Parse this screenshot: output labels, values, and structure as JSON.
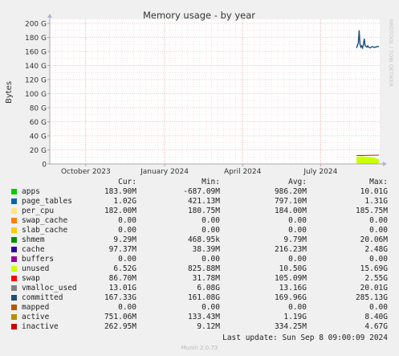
{
  "chart_data": {
    "type": "line",
    "title": "Memory usage - by year",
    "ylabel": "Bytes",
    "side_label": "RRDTOOL / TOBI OETIKER",
    "ylim": [
      0,
      200
    ],
    "yticks": [
      0,
      20,
      40,
      60,
      80,
      100,
      120,
      140,
      160,
      180,
      200
    ],
    "ytick_labels": [
      "0",
      "20 G",
      "40 G",
      "60 G",
      "80 G",
      "100 G",
      "120 G",
      "140 G",
      "160 G",
      "180 G",
      "200 G"
    ],
    "x_range": [
      "2023-08-20",
      "2024-09-08"
    ],
    "xticks": [
      "2023-10-01",
      "2024-01-01",
      "2024-04-01",
      "2024-07-01"
    ],
    "xtick_labels": [
      "October 2023",
      "January 2024",
      "April 2024",
      "July 2024"
    ],
    "grid": true,
    "series": [
      {
        "name": "committed",
        "color": "#1f4e79",
        "x": [
          "2024-08-12",
          "2024-08-14",
          "2024-08-15",
          "2024-08-16",
          "2024-08-17",
          "2024-08-18",
          "2024-08-19",
          "2024-08-20",
          "2024-08-21",
          "2024-08-22",
          "2024-08-23",
          "2024-08-24",
          "2024-08-25",
          "2024-08-26",
          "2024-08-28",
          "2024-08-30",
          "2024-09-01",
          "2024-09-03",
          "2024-09-05",
          "2024-09-07"
        ],
        "values": [
          165,
          172,
          190,
          170,
          166,
          168,
          165,
          170,
          178,
          168,
          167,
          166,
          168,
          166,
          165,
          167,
          166,
          166,
          167,
          167
        ]
      },
      {
        "name": "unused",
        "color": "#ccff00",
        "x": [
          "2024-08-12",
          "2024-08-18",
          "2024-08-26",
          "2024-09-02",
          "2024-09-07"
        ],
        "values": [
          10,
          11,
          10,
          9,
          6.5
        ]
      },
      {
        "name": "inactive",
        "color": "#cc0000",
        "x": [
          "2024-08-12",
          "2024-09-07"
        ],
        "values": [
          12,
          12.5
        ]
      }
    ],
    "legend": {
      "headers": [
        "Cur:",
        "Min:",
        "Avg:",
        "Max:"
      ],
      "rows": [
        {
          "name": "apps",
          "color": "#00cc00",
          "cur": "183.90M",
          "min": "-687.09M",
          "avg": "986.20M",
          "max": "10.01G"
        },
        {
          "name": "page_tables",
          "color": "#0066b3",
          "cur": "1.02G",
          "min": "421.13M",
          "avg": "797.10M",
          "max": "1.31G"
        },
        {
          "name": "per_cpu",
          "color": "#ffe680",
          "cur": "182.00M",
          "min": "180.75M",
          "avg": "184.00M",
          "max": "185.75M"
        },
        {
          "name": "swap_cache",
          "color": "#ff8000",
          "cur": "0.00",
          "min": "0.00",
          "avg": "0.00",
          "max": "0.00"
        },
        {
          "name": "slab_cache",
          "color": "#ffcc00",
          "cur": "0.00",
          "min": "0.00",
          "avg": "0.00",
          "max": "0.00"
        },
        {
          "name": "shmem",
          "color": "#008f00",
          "cur": "9.29M",
          "min": "468.95k",
          "avg": "9.79M",
          "max": "20.06M"
        },
        {
          "name": "cache",
          "color": "#330099",
          "cur": "97.37M",
          "min": "38.39M",
          "avg": "216.23M",
          "max": "2.48G"
        },
        {
          "name": "buffers",
          "color": "#990099",
          "cur": "0.00",
          "min": "0.00",
          "avg": "0.00",
          "max": "0.00"
        },
        {
          "name": "unused",
          "color": "#ccff00",
          "cur": "6.52G",
          "min": "825.88M",
          "avg": "10.50G",
          "max": "15.69G"
        },
        {
          "name": "swap",
          "color": "#ff0000",
          "cur": "86.70M",
          "min": "31.78M",
          "avg": "105.09M",
          "max": "2.55G"
        },
        {
          "name": "vmalloc_used",
          "color": "#808080",
          "cur": "13.01G",
          "min": "6.08G",
          "avg": "13.16G",
          "max": "20.01G"
        },
        {
          "name": "committed",
          "color": "#1f4e79",
          "cur": "167.33G",
          "min": "161.08G",
          "avg": "169.96G",
          "max": "285.13G"
        },
        {
          "name": "mapped",
          "color": "#b35900",
          "cur": "0.00",
          "min": "0.00",
          "avg": "0.00",
          "max": "0.00"
        },
        {
          "name": "active",
          "color": "#b38f00",
          "cur": "751.06M",
          "min": "133.43M",
          "avg": "1.19G",
          "max": "8.40G"
        },
        {
          "name": "inactive",
          "color": "#cc0000",
          "cur": "262.95M",
          "min": "9.12M",
          "avg": "334.25M",
          "max": "4.67G"
        }
      ]
    }
  },
  "footer": {
    "last_update": "Last update: Sun Sep  8 09:00:09 2024",
    "version": "Munin 2.0.73"
  }
}
